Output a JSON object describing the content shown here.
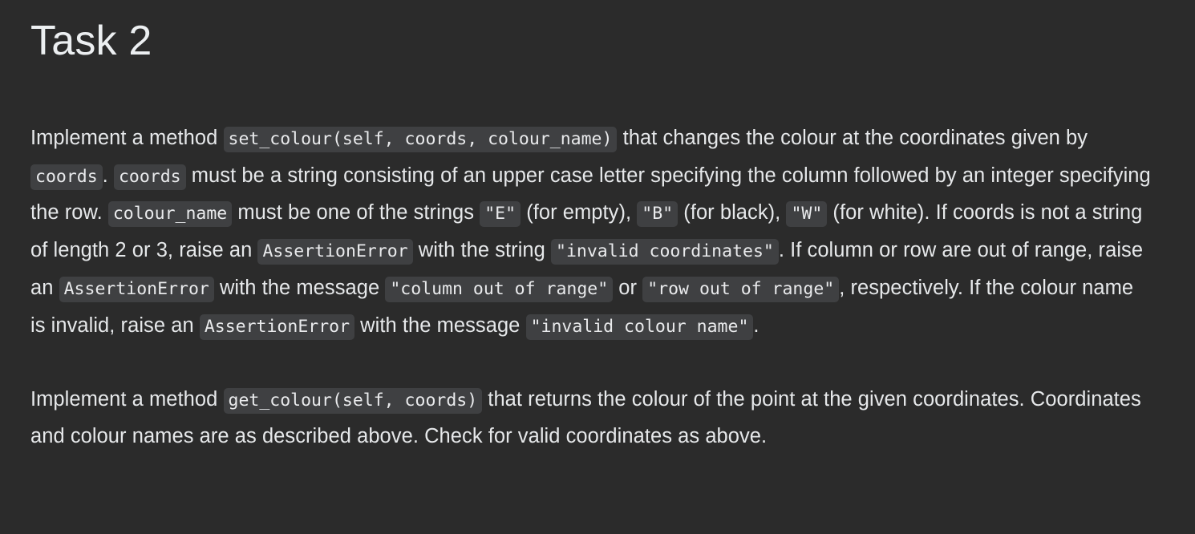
{
  "page": {
    "title": "Task 2",
    "background_color": "#2b2b2b",
    "text_color": "#e6e8ea",
    "code_background_color": "#3f4042",
    "code_text_color": "#e9eaec"
  },
  "paragraphs": [
    {
      "id": "set-colour-paragraph",
      "plain_text": "Implement a method set_colour(self, coords, colour_name) that changes the colour at the coordinates given by coords. coords must be a string consisting of an upper case letter specifying the column followed by an integer specifying the row. colour_name must be one of the strings \"E\" (for empty), \"B\" (for black), \"W\" (for white). If coords is not a string of length 2 or 3, raise an AssertionError with the string \"invalid coordinates\". If column or row are out of range, raise an AssertionError with the message \"column out of range\" or \"row out of range\", respectively. If the colour name is invalid, raise an AssertionError with the message \"invalid colour name\".",
      "runs": [
        {
          "type": "text",
          "value": "Implement a method "
        },
        {
          "type": "code",
          "value": "set_colour(self, coords, colour_name)"
        },
        {
          "type": "text",
          "value": " that changes the colour at the coordinates given by "
        },
        {
          "type": "code",
          "value": "coords"
        },
        {
          "type": "text",
          "value": ". "
        },
        {
          "type": "code",
          "value": "coords"
        },
        {
          "type": "text",
          "value": " must be a string consisting of an upper case letter specifying the column followed by an integer specifying the row. "
        },
        {
          "type": "code",
          "value": "colour_name"
        },
        {
          "type": "text",
          "value": " must be one of the strings "
        },
        {
          "type": "code",
          "value": "\"E\""
        },
        {
          "type": "text",
          "value": " (for empty), "
        },
        {
          "type": "code",
          "value": "\"B\""
        },
        {
          "type": "text",
          "value": " (for black), "
        },
        {
          "type": "code",
          "value": "\"W\""
        },
        {
          "type": "text",
          "value": " (for white). If coords is not a string of length 2 or 3, raise an "
        },
        {
          "type": "code",
          "value": "AssertionError"
        },
        {
          "type": "text",
          "value": " with the string "
        },
        {
          "type": "code",
          "value": "\"invalid coordinates\""
        },
        {
          "type": "text",
          "value": ". If column or row are out of range, raise an "
        },
        {
          "type": "code",
          "value": "AssertionError"
        },
        {
          "type": "text",
          "value": " with the message "
        },
        {
          "type": "code",
          "value": "\"column out of range\""
        },
        {
          "type": "text",
          "value": " or "
        },
        {
          "type": "code",
          "value": "\"row out of range\""
        },
        {
          "type": "text",
          "value": ", respectively. If the colour name is invalid, raise an "
        },
        {
          "type": "code",
          "value": "AssertionError"
        },
        {
          "type": "text",
          "value": " with the message "
        },
        {
          "type": "code",
          "value": "\"invalid colour name\""
        },
        {
          "type": "text",
          "value": "."
        }
      ]
    },
    {
      "id": "get-colour-paragraph",
      "plain_text": "Implement a method get_colour(self, coords) that returns the colour of the point at the given coordinates. Coordinates and colour names are as described above. Check for valid coordinates as above.",
      "runs": [
        {
          "type": "text",
          "value": "Implement a method "
        },
        {
          "type": "code",
          "value": "get_colour(self, coords)"
        },
        {
          "type": "text",
          "value": " that returns the colour of the point at the given coordinates. Coordinates and colour names are as described above. Check for valid coordinates as above."
        }
      ]
    }
  ]
}
